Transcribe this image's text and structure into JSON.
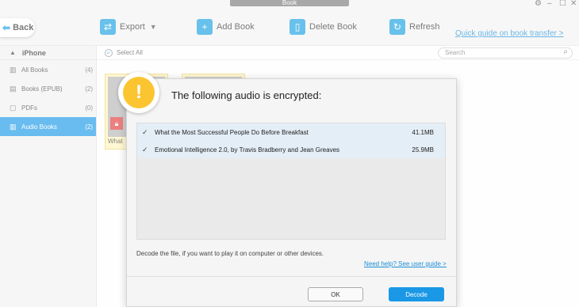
{
  "window": {
    "title": "Book",
    "controls": [
      "⚙",
      "–",
      "☐",
      "✕"
    ]
  },
  "toolbar": {
    "back_label": "Back",
    "export_label": "Export",
    "add_book_label": "Add Book",
    "delete_book_label": "Delete Book",
    "refresh_label": "Refresh",
    "quick_guide_link": "Quick guide on book transfer >"
  },
  "sidebar": {
    "device": "iPhone",
    "items": [
      {
        "label": "All Books",
        "count": "(4)"
      },
      {
        "label": "Books (EPUB)",
        "count": "(2)"
      },
      {
        "label": "PDFs",
        "count": "(0)"
      },
      {
        "label": "Audio Books",
        "count": "(2)"
      }
    ]
  },
  "content": {
    "select_all_label": "Select All",
    "search_placeholder": "Search",
    "book_partial_title": "What"
  },
  "dialog": {
    "title": "The following audio is encrypted:",
    "files": [
      {
        "name": "What the Most Successful People Do Before Breakfast",
        "size": "41.1MB"
      },
      {
        "name": "Emotional Intelligence 2.0, by Travis Bradberry and Jean Greaves",
        "size": "25.9MB"
      }
    ],
    "message": "Decode the file, if you want to play it on computer or other devices.",
    "help_link": "Need help? See user guide >",
    "ok_label": "OK",
    "decode_label": "Decode"
  },
  "colors": {
    "accent": "#1a98e6",
    "warning": "#fbc531",
    "lock": "#e23b3b",
    "book_highlight": "#fff3b8"
  }
}
